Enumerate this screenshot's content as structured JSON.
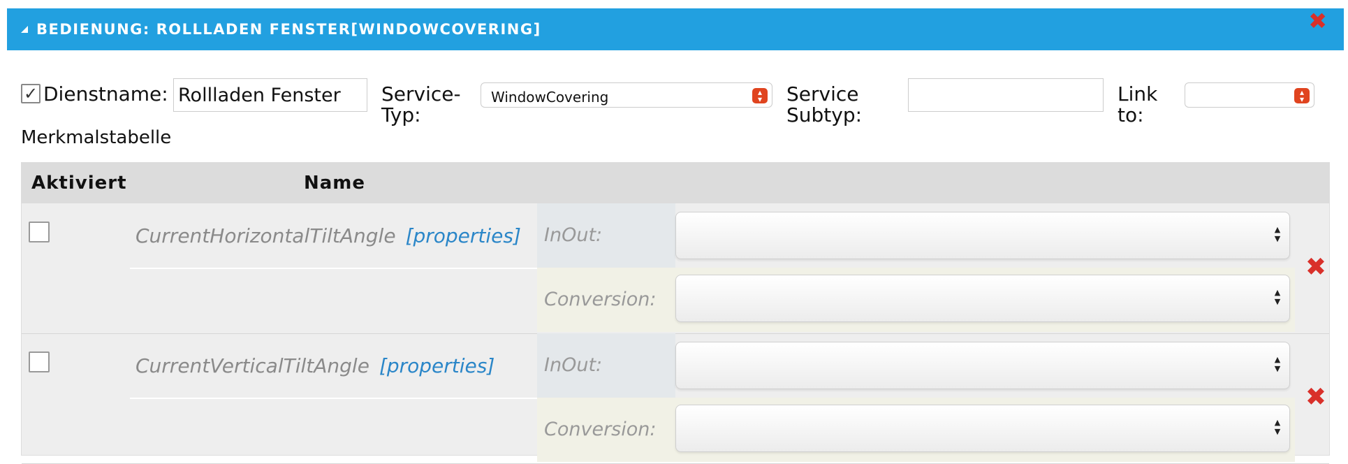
{
  "header": {
    "title": "BEDIENUNG: ROLLLADEN FENSTER[WINDOWCOVERING]"
  },
  "form": {
    "enabled_checked": true,
    "service_name_label": "Dienstname:",
    "service_name_value": "Rollladen Fenster",
    "service_type_label_1": "Service-",
    "service_type_label_2": "Typ:",
    "service_type_value": "WindowCovering",
    "service_subtype_label_1": "Service",
    "service_subtype_label_2": "Subtyp:",
    "service_subtype_value": "",
    "link_label_1": "Link",
    "link_label_2": "to:",
    "link_value": ""
  },
  "table": {
    "title": "Merkmalstabelle",
    "columns": [
      "Aktiviert",
      "Name"
    ],
    "rows": [
      {
        "name": "CurrentHorizontalTiltAngle",
        "properties_link": "[properties]",
        "inout_label": "InOut:",
        "inout_value": "",
        "conversion_label": "Conversion:",
        "conversion_value": "",
        "activated": false
      },
      {
        "name": "CurrentVerticalTiltAngle",
        "properties_link": "[properties]",
        "inout_label": "InOut:",
        "inout_value": "",
        "conversion_label": "Conversion:",
        "conversion_value": "",
        "activated": false
      }
    ]
  },
  "colors": {
    "header_bg": "#22a0e0",
    "delete_red": "#d9302a",
    "link_blue": "#2a86c8"
  },
  "icons": {
    "collapse": "triangle-collapse-icon",
    "close": "close-icon",
    "delete": "delete-icon",
    "select": "select-arrows-icon"
  }
}
